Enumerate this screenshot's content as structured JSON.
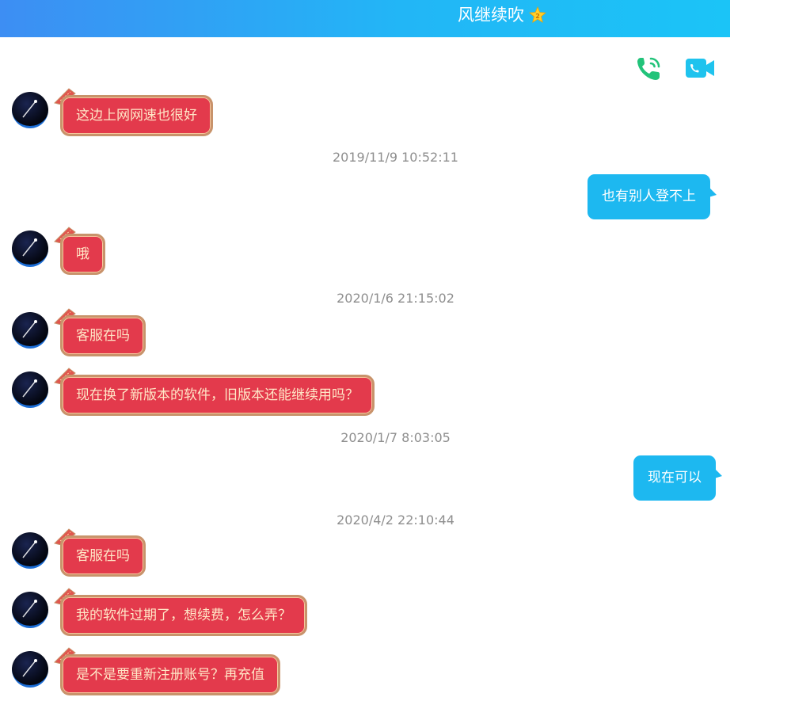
{
  "header": {
    "title": "风继续吹",
    "badge_icon": "star-badge-icon"
  },
  "call_actions": {
    "voice_icon": "phone-call-icon",
    "video_icon": "video-camera-icon"
  },
  "messages": [
    {
      "side": "them",
      "text": "这边上网网速也很好"
    },
    {
      "timestamp": "2019/11/9 10:52:11"
    },
    {
      "side": "me",
      "text": "也有别人登不上"
    },
    {
      "side": "them",
      "text": "哦"
    },
    {
      "timestamp": "2020/1/6 21:15:02"
    },
    {
      "side": "them",
      "text": "客服在吗"
    },
    {
      "side": "them",
      "text": "现在换了新版本的软件，旧版本还能继续用吗？"
    },
    {
      "timestamp": "2020/1/7 8:03:05"
    },
    {
      "side": "me",
      "text": "现在可以"
    },
    {
      "timestamp": "2020/4/2 22:10:44"
    },
    {
      "side": "them",
      "text": "客服在吗"
    },
    {
      "side": "them",
      "text": "我的软件过期了，想续费，怎么弄？"
    },
    {
      "side": "them",
      "text": "是不是要重新注册账号？再充值"
    }
  ],
  "colors": {
    "header_start": "#3d8ef3",
    "header_end": "#1bc4f7",
    "their_bubble": "#e33a4c",
    "their_text": "#ffe7c7",
    "my_bubble": "#1db8f0",
    "timestamp_text": "#8e8e8e",
    "phone_icon": "#22c37a",
    "video_icon": "#1fc3ee"
  }
}
